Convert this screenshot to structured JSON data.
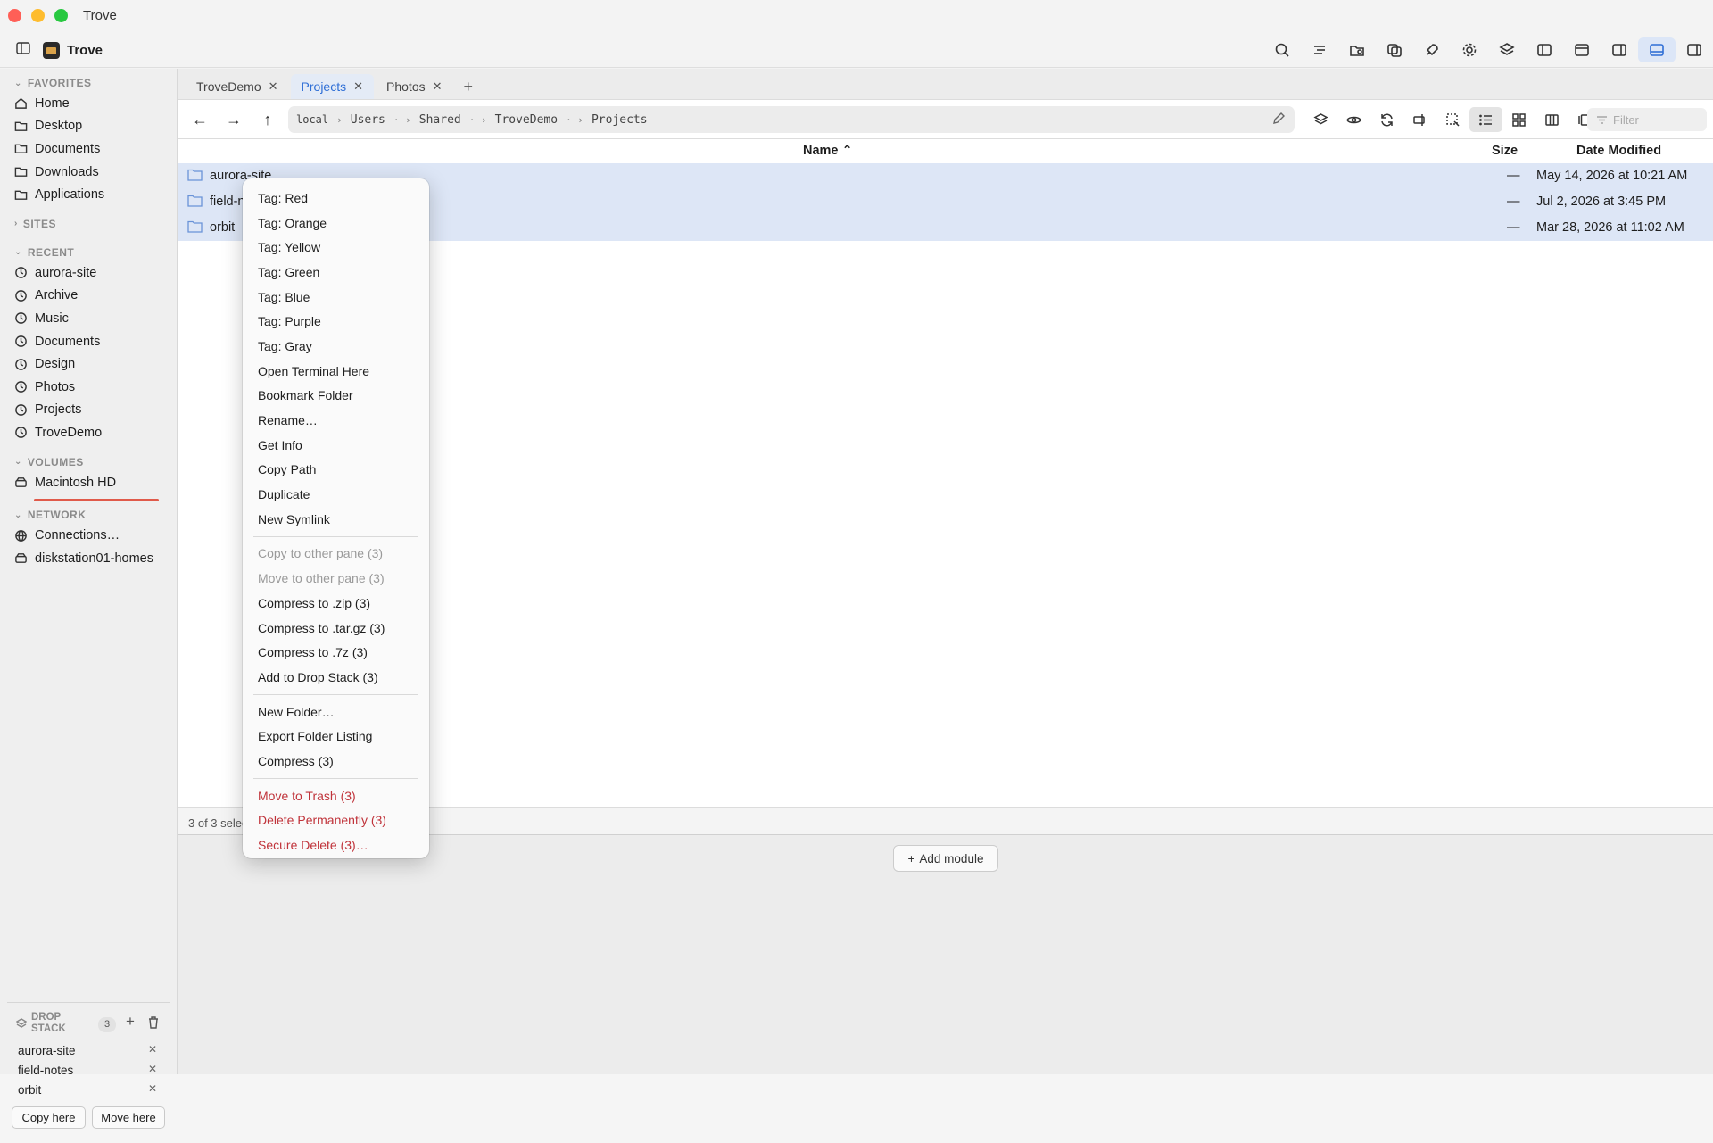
{
  "window": {
    "title": "Trove"
  },
  "app": {
    "name": "Trove"
  },
  "sidebar": {
    "favorites_label": "FAVORITES",
    "favorites": [
      "Home",
      "Desktop",
      "Documents",
      "Downloads",
      "Applications"
    ],
    "sites_label": "SITES",
    "recent_label": "RECENT",
    "recent": [
      "aurora-site",
      "Archive",
      "Music",
      "Documents",
      "Design",
      "Photos",
      "Projects",
      "TroveDemo"
    ],
    "volumes_label": "VOLUMES",
    "volumes": [
      "Macintosh HD"
    ],
    "network_label": "NETWORK",
    "network": [
      "Connections…",
      "diskstation01-homes"
    ]
  },
  "tabs": [
    {
      "label": "TroveDemo",
      "active": false
    },
    {
      "label": "Projects",
      "active": true
    },
    {
      "label": "Photos",
      "active": false
    }
  ],
  "path": {
    "root": "local",
    "segments": [
      "Users",
      "Shared",
      "TroveDemo",
      "Projects"
    ]
  },
  "filter": {
    "placeholder": "Filter"
  },
  "columns": {
    "name": "Name ⌃",
    "size": "Size",
    "date": "Date Modified"
  },
  "rows": [
    {
      "name": "aurora-site",
      "size": "—",
      "date": "May 14, 2026 at 10:21 AM"
    },
    {
      "name": "field-notes",
      "size": "—",
      "date": "Jul 2, 2026 at 3:45 PM"
    },
    {
      "name": "orbit",
      "size": "—",
      "date": "Mar 28, 2026 at 11:02 AM"
    }
  ],
  "status": {
    "text": "3 of 3 selected"
  },
  "add_module": "Add module",
  "drop_stack": {
    "title_line1": "DROP",
    "title_line2": "STACK",
    "count": "3",
    "items": [
      "aurora-site",
      "field-notes",
      "orbit"
    ],
    "copy_label": "Copy here",
    "move_label": "Move here"
  },
  "context_menu": {
    "group1": [
      "Tag: Red",
      "Tag: Orange",
      "Tag: Yellow",
      "Tag: Green",
      "Tag: Blue",
      "Tag: Purple",
      "Tag: Gray",
      "Open Terminal Here",
      "Bookmark Folder",
      "Rename…",
      "Get Info",
      "Copy Path",
      "Duplicate",
      "New Symlink"
    ],
    "group2_disabled": [
      "Copy to other pane (3)",
      "Move to other pane (3)"
    ],
    "group2": [
      "Compress to .zip (3)",
      "Compress to .tar.gz (3)",
      "Compress to .7z (3)",
      "Add to Drop Stack (3)"
    ],
    "group3": [
      "New Folder…",
      "Export Folder Listing",
      "Compress (3)"
    ],
    "group4_danger": [
      "Move to Trash (3)",
      "Delete Permanently (3)",
      "Secure Delete (3)…"
    ]
  },
  "colors": {
    "accent": "#2f6fd6",
    "selection": "#dde6f6",
    "danger": "#c0333a",
    "redline": "#e05a4a"
  }
}
